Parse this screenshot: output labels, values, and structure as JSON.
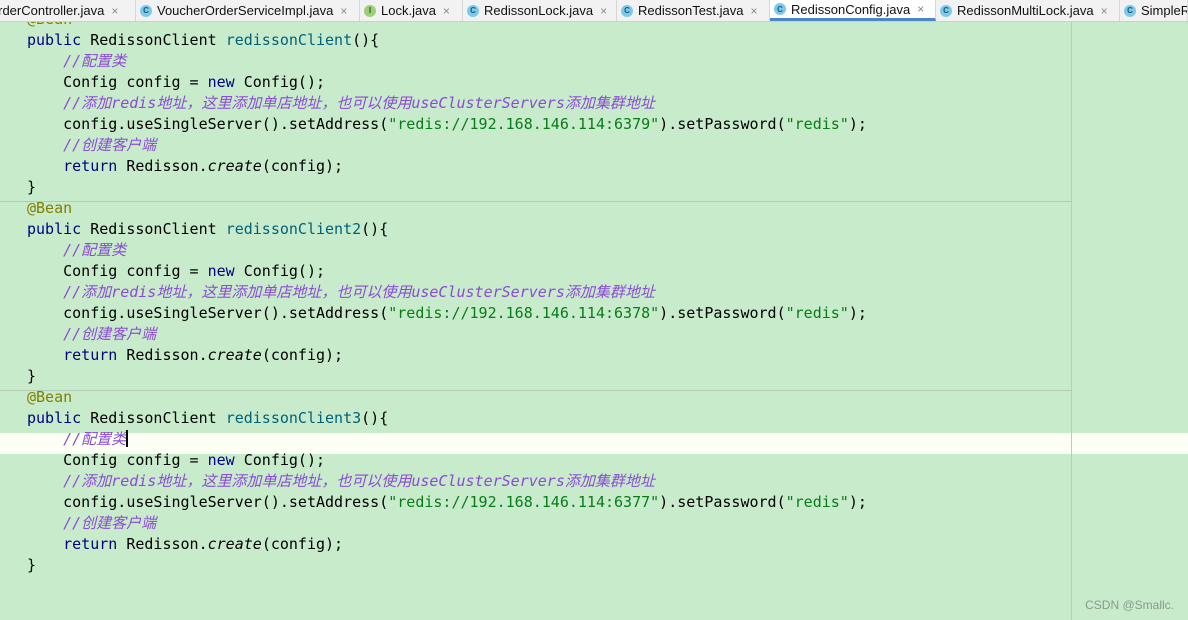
{
  "tabs": [
    {
      "label": "OrderController.java",
      "icon": "class-icon",
      "icon_glyph": "C",
      "active": false
    },
    {
      "label": "VoucherOrderServiceImpl.java",
      "icon": "class-icon",
      "icon_glyph": "C",
      "active": false
    },
    {
      "label": "Lock.java",
      "icon": "interface-icon",
      "icon_glyph": "I",
      "active": false
    },
    {
      "label": "RedissonLock.java",
      "icon": "class-icon",
      "icon_glyph": "C",
      "active": false
    },
    {
      "label": "RedissonTest.java",
      "icon": "test-class-icon",
      "icon_glyph": "C",
      "active": false
    },
    {
      "label": "RedissonConfig.java",
      "icon": "class-icon",
      "icon_glyph": "C",
      "active": true
    },
    {
      "label": "RedissonMultiLock.java",
      "icon": "class-icon",
      "icon_glyph": "C",
      "active": false
    },
    {
      "label": "SimpleR",
      "icon": "class-icon",
      "icon_glyph": "C",
      "active": false
    }
  ],
  "tab_close_glyph": "×",
  "colors": {
    "editor_background": "#c8ebcc",
    "current_line": "#fcfff4",
    "keyword": "#000080",
    "annotation": "#808000",
    "method_name": "#00627a",
    "string": "#067d17",
    "comment": "#8c4ad6",
    "active_tab_underline": "#4a86c8"
  },
  "code": {
    "blocks": [
      {
        "annotation": "@Bean",
        "method": "redissonClient",
        "address": "\"redis://192.168.146.114:6379\""
      },
      {
        "annotation": "@Bean",
        "method": "redissonClient2",
        "address": "\"redis://192.168.146.114:6378\""
      },
      {
        "annotation": "@Bean",
        "method": "redissonClient3",
        "address": "\"redis://192.168.146.114:6377\""
      }
    ],
    "kw_public": "public",
    "return_type": " RedissonClient ",
    "open_sig": "(){",
    "comment_config": "//配置类",
    "config_decl_a": "Config config = ",
    "kw_new": "new",
    "config_decl_b": " Config();",
    "comment_address": "//添加redis地址，这里添加单店地址，也可以使用useClusterServers添加集群地址",
    "set_address_a": "config.useSingleServer().setAddress(",
    "set_address_b": ").setPassword(",
    "password": "\"redis\"",
    "set_address_c": ");",
    "comment_client": "//创建客户端",
    "kw_return": "return",
    "return_a": " Redisson.",
    "create_method": "create",
    "return_b": "(config);",
    "close_brace": "}"
  },
  "watermark": "CSDN @Smallc."
}
